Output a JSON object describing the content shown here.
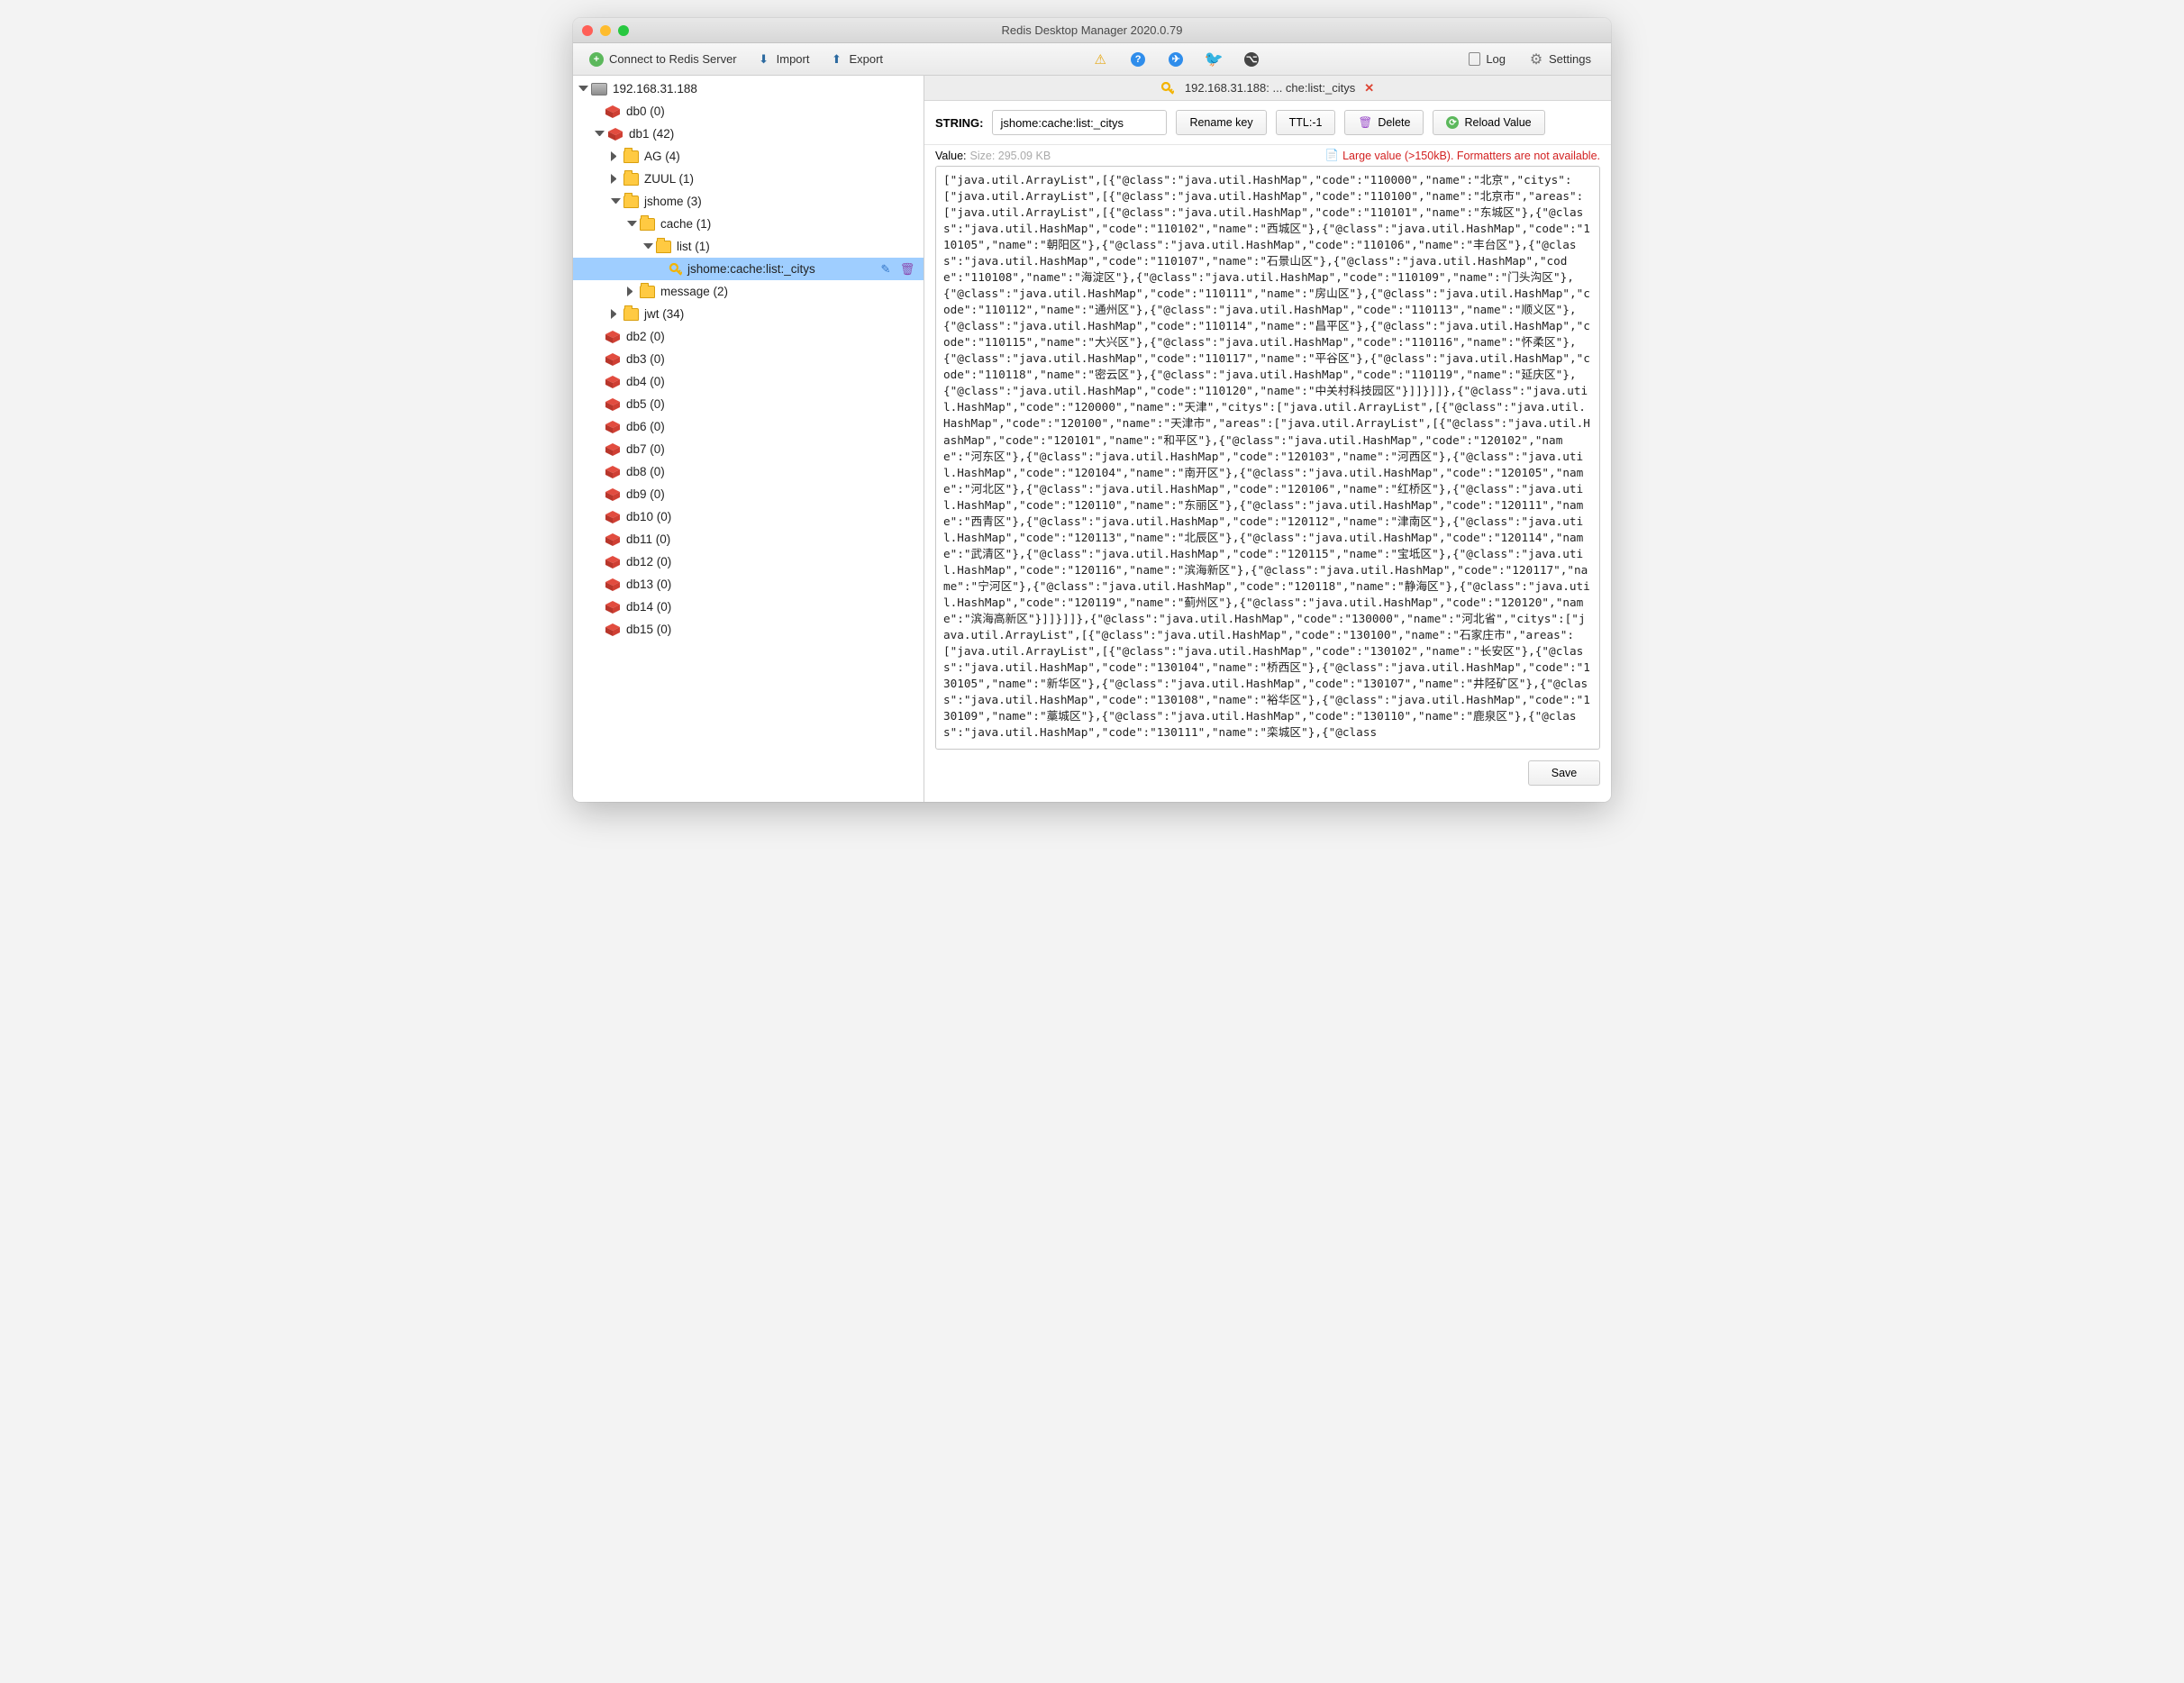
{
  "window": {
    "title": "Redis Desktop Manager 2020.0.79"
  },
  "toolbar": {
    "connect": "Connect to Redis Server",
    "import": "Import",
    "export": "Export",
    "log": "Log",
    "settings": "Settings"
  },
  "tree": {
    "server": "192.168.31.188",
    "db0": "db0  (0)",
    "db1": "db1  (42)",
    "ag": "AG (4)",
    "zuul": "ZUUL (1)",
    "jshome": "jshome (3)",
    "cache": "cache (1)",
    "list": "list (1)",
    "selected_key": "jshome:cache:list:_citys",
    "message": "message (2)",
    "jwt": "jwt (34)",
    "db2": "db2  (0)",
    "db3": "db3  (0)",
    "db4": "db4  (0)",
    "db5": "db5  (0)",
    "db6": "db6  (0)",
    "db7": "db7  (0)",
    "db8": "db8  (0)",
    "db9": "db9  (0)",
    "db10": "db10  (0)",
    "db11": "db11  (0)",
    "db12": "db12  (0)",
    "db13": "db13  (0)",
    "db14": "db14  (0)",
    "db15": "db15  (0)"
  },
  "tab": {
    "label": "192.168.31.188: ... che:list:_citys"
  },
  "detail": {
    "type": "STRING:",
    "keyname": "jshome:cache:list:_citys",
    "rename": "Rename key",
    "ttl": "TTL:-1",
    "delete": "Delete",
    "reload": "Reload Value",
    "value_label": "Value:",
    "size": "Size: 295.09 KB",
    "warning": "Large value (>150kB). Formatters are not available.",
    "save": "Save",
    "content": "[\"java.util.ArrayList\",[{\"@class\":\"java.util.HashMap\",\"code\":\"110000\",\"name\":\"北京\",\"citys\":[\"java.util.ArrayList\",[{\"@class\":\"java.util.HashMap\",\"code\":\"110100\",\"name\":\"北京市\",\"areas\":[\"java.util.ArrayList\",[{\"@class\":\"java.util.HashMap\",\"code\":\"110101\",\"name\":\"东城区\"},{\"@class\":\"java.util.HashMap\",\"code\":\"110102\",\"name\":\"西城区\"},{\"@class\":\"java.util.HashMap\",\"code\":\"110105\",\"name\":\"朝阳区\"},{\"@class\":\"java.util.HashMap\",\"code\":\"110106\",\"name\":\"丰台区\"},{\"@class\":\"java.util.HashMap\",\"code\":\"110107\",\"name\":\"石景山区\"},{\"@class\":\"java.util.HashMap\",\"code\":\"110108\",\"name\":\"海淀区\"},{\"@class\":\"java.util.HashMap\",\"code\":\"110109\",\"name\":\"门头沟区\"},{\"@class\":\"java.util.HashMap\",\"code\":\"110111\",\"name\":\"房山区\"},{\"@class\":\"java.util.HashMap\",\"code\":\"110112\",\"name\":\"通州区\"},{\"@class\":\"java.util.HashMap\",\"code\":\"110113\",\"name\":\"顺义区\"},{\"@class\":\"java.util.HashMap\",\"code\":\"110114\",\"name\":\"昌平区\"},{\"@class\":\"java.util.HashMap\",\"code\":\"110115\",\"name\":\"大兴区\"},{\"@class\":\"java.util.HashMap\",\"code\":\"110116\",\"name\":\"怀柔区\"},{\"@class\":\"java.util.HashMap\",\"code\":\"110117\",\"name\":\"平谷区\"},{\"@class\":\"java.util.HashMap\",\"code\":\"110118\",\"name\":\"密云区\"},{\"@class\":\"java.util.HashMap\",\"code\":\"110119\",\"name\":\"延庆区\"},{\"@class\":\"java.util.HashMap\",\"code\":\"110120\",\"name\":\"中关村科技园区\"}]]}]]},{\"@class\":\"java.util.HashMap\",\"code\":\"120000\",\"name\":\"天津\",\"citys\":[\"java.util.ArrayList\",[{\"@class\":\"java.util.HashMap\",\"code\":\"120100\",\"name\":\"天津市\",\"areas\":[\"java.util.ArrayList\",[{\"@class\":\"java.util.HashMap\",\"code\":\"120101\",\"name\":\"和平区\"},{\"@class\":\"java.util.HashMap\",\"code\":\"120102\",\"name\":\"河东区\"},{\"@class\":\"java.util.HashMap\",\"code\":\"120103\",\"name\":\"河西区\"},{\"@class\":\"java.util.HashMap\",\"code\":\"120104\",\"name\":\"南开区\"},{\"@class\":\"java.util.HashMap\",\"code\":\"120105\",\"name\":\"河北区\"},{\"@class\":\"java.util.HashMap\",\"code\":\"120106\",\"name\":\"红桥区\"},{\"@class\":\"java.util.HashMap\",\"code\":\"120110\",\"name\":\"东丽区\"},{\"@class\":\"java.util.HashMap\",\"code\":\"120111\",\"name\":\"西青区\"},{\"@class\":\"java.util.HashMap\",\"code\":\"120112\",\"name\":\"津南区\"},{\"@class\":\"java.util.HashMap\",\"code\":\"120113\",\"name\":\"北辰区\"},{\"@class\":\"java.util.HashMap\",\"code\":\"120114\",\"name\":\"武清区\"},{\"@class\":\"java.util.HashMap\",\"code\":\"120115\",\"name\":\"宝坻区\"},{\"@class\":\"java.util.HashMap\",\"code\":\"120116\",\"name\":\"滨海新区\"},{\"@class\":\"java.util.HashMap\",\"code\":\"120117\",\"name\":\"宁河区\"},{\"@class\":\"java.util.HashMap\",\"code\":\"120118\",\"name\":\"静海区\"},{\"@class\":\"java.util.HashMap\",\"code\":\"120119\",\"name\":\"蓟州区\"},{\"@class\":\"java.util.HashMap\",\"code\":\"120120\",\"name\":\"滨海高新区\"}]]}]]},{\"@class\":\"java.util.HashMap\",\"code\":\"130000\",\"name\":\"河北省\",\"citys\":[\"java.util.ArrayList\",[{\"@class\":\"java.util.HashMap\",\"code\":\"130100\",\"name\":\"石家庄市\",\"areas\":[\"java.util.ArrayList\",[{\"@class\":\"java.util.HashMap\",\"code\":\"130102\",\"name\":\"长安区\"},{\"@class\":\"java.util.HashMap\",\"code\":\"130104\",\"name\":\"桥西区\"},{\"@class\":\"java.util.HashMap\",\"code\":\"130105\",\"name\":\"新华区\"},{\"@class\":\"java.util.HashMap\",\"code\":\"130107\",\"name\":\"井陉矿区\"},{\"@class\":\"java.util.HashMap\",\"code\":\"130108\",\"name\":\"裕华区\"},{\"@class\":\"java.util.HashMap\",\"code\":\"130109\",\"name\":\"藁城区\"},{\"@class\":\"java.util.HashMap\",\"code\":\"130110\",\"name\":\"鹿泉区\"},{\"@class\":\"java.util.HashMap\",\"code\":\"130111\",\"name\":\"栾城区\"},{\"@class"
  }
}
